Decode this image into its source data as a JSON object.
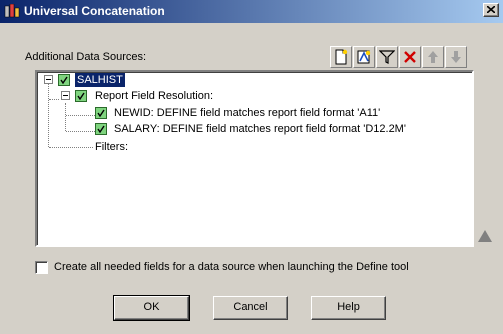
{
  "window": {
    "title": "Universal Concatenation"
  },
  "sources_label": "Additional Data Sources:",
  "toolbar": [
    {
      "name": "new-source-icon"
    },
    {
      "name": "define-icon"
    },
    {
      "name": "filter-icon"
    },
    {
      "name": "delete-icon"
    },
    {
      "name": "move-up-icon"
    },
    {
      "name": "move-down-icon"
    }
  ],
  "tree": {
    "root": "SALHIST",
    "report_field_resolution": "Report Field Resolution:",
    "fields": [
      "NEWID: DEFINE field matches report field format 'A11'",
      "SALARY: DEFINE field matches report field format 'D12.2M'"
    ],
    "filters": "Filters:"
  },
  "checkbox_label": "Create all needed fields for a data source when launching the Define tool",
  "buttons": {
    "ok": "OK",
    "cancel": "Cancel",
    "help": "Help"
  }
}
